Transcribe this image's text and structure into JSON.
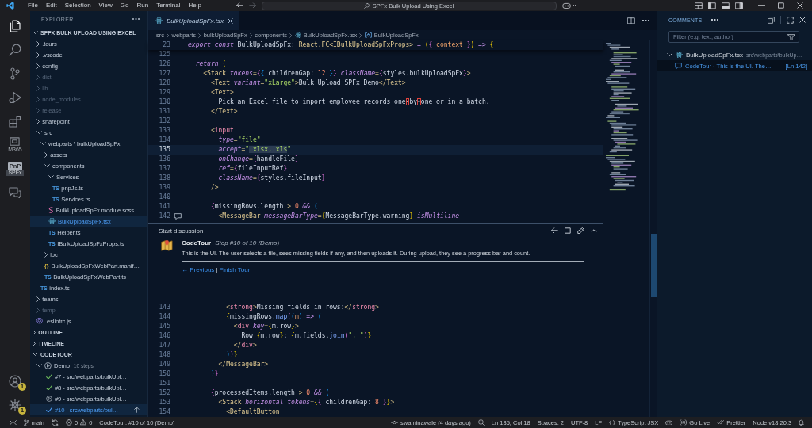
{
  "title_bar": {
    "menu": [
      "File",
      "Edit",
      "Selection",
      "View",
      "Go",
      "Run",
      "Terminal",
      "Help"
    ],
    "command_center": "SPFx Bulk Upload Using Excel"
  },
  "activity_bar": {
    "items": [
      {
        "kind": "explorer",
        "selected": true
      },
      {
        "kind": "search",
        "selected": false
      },
      {
        "kind": "scm",
        "selected": false
      },
      {
        "kind": "debug",
        "selected": false
      },
      {
        "kind": "extensions",
        "selected": false
      },
      {
        "kind": "toolkit",
        "selected": false,
        "caption": "M365"
      },
      {
        "kind": "pnp",
        "selected": false,
        "label": "PnP",
        "caption": "SPFx"
      },
      {
        "kind": "chat",
        "selected": false
      }
    ],
    "bottom": [
      {
        "kind": "account",
        "badge": "1"
      },
      {
        "kind": "settings",
        "badge": "1"
      }
    ]
  },
  "sidebar": {
    "title": "EXPLORER",
    "sections": [
      {
        "title": "SPFX BULK UPLOAD USING EXCEL",
        "kind": "files",
        "expanded": true,
        "tree": [
          {
            "name": ".tours",
            "kind": "folder",
            "expanded": false,
            "dimmed": false,
            "selected": false
          },
          {
            "name": ".vscode",
            "kind": "folder",
            "expanded": false,
            "dimmed": false,
            "selected": false
          },
          {
            "name": "config",
            "kind": "folder",
            "expanded": false,
            "dimmed": false,
            "selected": false
          },
          {
            "name": "dist",
            "kind": "folder",
            "expanded": false,
            "dimmed": true,
            "selected": false
          },
          {
            "name": "lib",
            "kind": "folder",
            "expanded": false,
            "dimmed": true,
            "selected": false
          },
          {
            "name": "node_modules",
            "kind": "folder",
            "expanded": false,
            "dimmed": true,
            "selected": false
          },
          {
            "name": "release",
            "kind": "folder",
            "expanded": false,
            "dimmed": true,
            "selected": false
          },
          {
            "name": "sharepoint",
            "kind": "folder",
            "expanded": false,
            "dimmed": false,
            "selected": false
          },
          {
            "name": "src",
            "kind": "folder",
            "expanded": true,
            "dimmed": false,
            "selected": false,
            "children": [
              {
                "name": "webparts \\ bulkUploadSpFx",
                "kind": "folder",
                "expanded": true,
                "dimmed": false,
                "selected": false,
                "children": [
                  {
                    "name": "assets",
                    "kind": "folder",
                    "expanded": false,
                    "dimmed": false,
                    "selected": false
                  },
                  {
                    "name": "components",
                    "kind": "folder",
                    "expanded": true,
                    "dimmed": false,
                    "selected": false,
                    "children": [
                      {
                        "name": "Services",
                        "kind": "folder",
                        "expanded": true,
                        "dimmed": false,
                        "selected": false,
                        "children": [
                          {
                            "name": "pnpJs.ts",
                            "kind": "ts",
                            "glyph": "TS",
                            "dimmed": false,
                            "selected": false
                          },
                          {
                            "name": "Services.ts",
                            "kind": "ts",
                            "glyph": "TS",
                            "dimmed": false,
                            "selected": false
                          }
                        ]
                      },
                      {
                        "name": "BulkUploadSpFx.module.scss",
                        "kind": "scss",
                        "dimmed": false,
                        "selected": false
                      },
                      {
                        "name": "BulkUploadSpFx.tsx",
                        "kind": "tsx",
                        "dimmed": false,
                        "selected": true
                      },
                      {
                        "name": "Helper.ts",
                        "kind": "ts",
                        "glyph": "TS",
                        "dimmed": false,
                        "selected": false
                      },
                      {
                        "name": "IBulkUploadSpFxProps.ts",
                        "kind": "ts",
                        "glyph": "TS",
                        "dimmed": false,
                        "selected": false
                      }
                    ]
                  },
                  {
                    "name": "loc",
                    "kind": "folder",
                    "expanded": false,
                    "dimmed": false,
                    "selected": false
                  },
                  {
                    "name": "BulkUploadSpFxWebPart.manif…",
                    "kind": "json",
                    "glyph": "{}",
                    "dimmed": false,
                    "selected": false
                  },
                  {
                    "name": "BulkUploadSpFxWebPart.ts",
                    "kind": "ts",
                    "glyph": "TS",
                    "dimmed": false,
                    "selected": false
                  }
                ]
              },
              {
                "name": "index.ts",
                "kind": "ts",
                "glyph": "TS",
                "dimmed": false,
                "selected": false
              }
            ]
          },
          {
            "name": "teams",
            "kind": "folder",
            "expanded": false,
            "dimmed": false,
            "selected": false
          },
          {
            "name": "temp",
            "kind": "folder",
            "expanded": false,
            "dimmed": true,
            "selected": false
          },
          {
            "name": ".eslintrc.js",
            "kind": "eslint",
            "dimmed": false,
            "selected": false
          }
        ]
      },
      {
        "title": "OUTLINE",
        "expanded": false
      },
      {
        "title": "TIMELINE",
        "expanded": false
      },
      {
        "title": "CODETOUR",
        "kind": "tours",
        "expanded": true,
        "tours": [
          {
            "name": "Demo",
            "description": "10 steps",
            "expanded": true,
            "steps": [
              {
                "label": "#7 - src/webparts/bulkUpl…",
                "kind": "visited",
                "selected": false
              },
              {
                "label": "#8 - src/webparts/bulkUpl…",
                "kind": "visited",
                "selected": false
              },
              {
                "label": "#9 - src/webparts/bulkUpl…",
                "kind": "unvisited",
                "selected": false
              },
              {
                "label": "#10 - src/webparts/bul…",
                "kind": "visited",
                "selected": true
              }
            ]
          }
        ]
      }
    ]
  },
  "editor": {
    "tabs": [
      {
        "label": "BulkUploadSpFx.tsx",
        "selected": true,
        "preview": true
      }
    ],
    "breadcrumbs": [
      {
        "label": "src",
        "kind": "folder"
      },
      {
        "label": "webparts",
        "kind": "folder"
      },
      {
        "label": "bulkUploadSpFx",
        "kind": "folder"
      },
      {
        "label": "components",
        "kind": "folder"
      },
      {
        "label": "BulkUploadSpFx.tsx",
        "kind": "file"
      },
      {
        "label": "BulkUploadSpFx",
        "kind": "symbol"
      }
    ],
    "sticky_line": {
      "number": "23",
      "tokens": [
        {
          "text": "export const",
          "kind": "keyword"
        },
        {
          "text": " BulkUploadSpFx: ",
          "kind": "text"
        },
        {
          "text": "React.FC<IBulkUploadSpFxProps>",
          "kind": "tag"
        },
        {
          "text": " =",
          "kind": "keyword"
        },
        {
          "text": " (",
          "kind": "bracket"
        },
        {
          "text": "{",
          "kind": "bracket2"
        },
        {
          "text": " context",
          "kind": "param"
        },
        {
          "text": " }",
          "kind": "bracket2"
        },
        {
          "text": ")",
          "kind": "bracket"
        },
        {
          "text": " =>",
          "kind": "keyword"
        },
        {
          "text": " {",
          "kind": "bracket"
        }
      ]
    },
    "lines": [
      {
        "number": "125",
        "current": false,
        "comment": false
      },
      {
        "number": "126",
        "current": false,
        "comment": false,
        "tokens": [
          {
            "text": "  return ",
            "kind": "keyword"
          },
          {
            "text": "(",
            "kind": "bracket"
          }
        ]
      },
      {
        "number": "127",
        "current": false,
        "comment": false,
        "tokens": [
          {
            "text": "    <",
            "kind": "punct"
          },
          {
            "text": "Stack",
            "kind": "tag"
          },
          {
            "text": " tokens",
            "kind": "attr"
          },
          {
            "text": "=",
            "kind": "punct"
          },
          {
            "text": "{",
            "kind": "bracket2"
          },
          {
            "text": "{",
            "kind": "bracket3"
          },
          {
            "text": " childrenGap: ",
            "kind": "text"
          },
          {
            "text": "12",
            "kind": "number"
          },
          {
            "text": " }",
            "kind": "bracket3"
          },
          {
            "text": "}",
            "kind": "bracket2"
          },
          {
            "text": " className",
            "kind": "attr"
          },
          {
            "text": "=",
            "kind": "punct"
          },
          {
            "text": "{",
            "kind": "bracket2"
          },
          {
            "text": "styles.bulkUploadSpFx",
            "kind": "text"
          },
          {
            "text": "}",
            "kind": "bracket2"
          },
          {
            "text": ">",
            "kind": "punct"
          }
        ]
      },
      {
        "number": "128",
        "current": false,
        "comment": false,
        "tokens": [
          {
            "text": "      <",
            "kind": "punct"
          },
          {
            "text": "Text",
            "kind": "tag"
          },
          {
            "text": " variant",
            "kind": "attr"
          },
          {
            "text": "=",
            "kind": "punct"
          },
          {
            "text": "\"xLarge\"",
            "kind": "string"
          },
          {
            "text": ">",
            "kind": "punct"
          },
          {
            "text": "Bulk Upload SPFx Demo",
            "kind": "text"
          },
          {
            "text": "</",
            "kind": "punct"
          },
          {
            "text": "Text",
            "kind": "tag"
          },
          {
            "text": ">",
            "kind": "punct"
          }
        ]
      },
      {
        "number": "129",
        "current": false,
        "comment": false,
        "tokens": [
          {
            "text": "      <",
            "kind": "punct"
          },
          {
            "text": "Text",
            "kind": "tag"
          },
          {
            "text": ">",
            "kind": "punct"
          }
        ]
      },
      {
        "number": "130",
        "current": false,
        "comment": false,
        "tokens": [
          {
            "text": "        Pick an Excel file to import employee records one",
            "kind": "text"
          },
          {
            "text": "‐",
            "kind": "flag"
          },
          {
            "text": "by",
            "kind": "text"
          },
          {
            "text": "‐",
            "kind": "flag"
          },
          {
            "text": "one or in a batch.",
            "kind": "text"
          }
        ]
      },
      {
        "number": "131",
        "current": false,
        "comment": false,
        "tokens": [
          {
            "text": "      </",
            "kind": "punct"
          },
          {
            "text": "Text",
            "kind": "tag"
          },
          {
            "text": ">",
            "kind": "punct"
          }
        ]
      },
      {
        "number": "132",
        "current": false,
        "comment": false
      },
      {
        "number": "133",
        "current": false,
        "comment": false,
        "tokens": [
          {
            "text": "      <",
            "kind": "punct"
          },
          {
            "text": "input",
            "kind": "element"
          }
        ]
      },
      {
        "number": "134",
        "current": false,
        "comment": false,
        "tokens": [
          {
            "text": "        type",
            "kind": "attr"
          },
          {
            "text": "=",
            "kind": "punct"
          },
          {
            "text": "\"file\"",
            "kind": "string"
          }
        ]
      },
      {
        "number": "135",
        "current": true,
        "comment": false,
        "tokens": [
          {
            "text": "        accept",
            "kind": "attr"
          },
          {
            "text": "=",
            "kind": "punct"
          },
          {
            "text": "\"",
            "kind": "string"
          },
          {
            "text": ".xlsx,.xls",
            "kind": "match"
          },
          {
            "text": "\"",
            "kind": "string"
          }
        ]
      },
      {
        "number": "136",
        "current": false,
        "comment": false,
        "tokens": [
          {
            "text": "        onChange",
            "kind": "attr"
          },
          {
            "text": "=",
            "kind": "punct"
          },
          {
            "text": "{",
            "kind": "bracket2"
          },
          {
            "text": "handleFile",
            "kind": "text"
          },
          {
            "text": "}",
            "kind": "bracket2"
          }
        ]
      },
      {
        "number": "137",
        "current": false,
        "comment": false,
        "tokens": [
          {
            "text": "        ref",
            "kind": "attr"
          },
          {
            "text": "=",
            "kind": "punct"
          },
          {
            "text": "{",
            "kind": "bracket2"
          },
          {
            "text": "fileInputRef",
            "kind": "text"
          },
          {
            "text": "}",
            "kind": "bracket2"
          }
        ]
      },
      {
        "number": "138",
        "current": false,
        "comment": false,
        "tokens": [
          {
            "text": "        className",
            "kind": "attr"
          },
          {
            "text": "=",
            "kind": "punct"
          },
          {
            "text": "{",
            "kind": "bracket2"
          },
          {
            "text": "styles.fileInput",
            "kind": "text"
          },
          {
            "text": "}",
            "kind": "bracket2"
          }
        ]
      },
      {
        "number": "139",
        "current": false,
        "comment": false,
        "tokens": [
          {
            "text": "      />",
            "kind": "punct"
          }
        ]
      },
      {
        "number": "140",
        "current": false,
        "comment": false
      },
      {
        "number": "141",
        "current": false,
        "comment": false,
        "tokens": [
          {
            "text": "      {",
            "kind": "bracket2"
          },
          {
            "text": "missingRows.length ",
            "kind": "text"
          },
          {
            "text": ">",
            "kind": "punct"
          },
          {
            "text": " 0",
            "kind": "number"
          },
          {
            "text": " &&",
            "kind": "keyword"
          },
          {
            "text": " (",
            "kind": "bracket3"
          }
        ]
      },
      {
        "number": "142",
        "current": false,
        "comment": true,
        "tokens": [
          {
            "text": "        <",
            "kind": "punct"
          },
          {
            "text": "MessageBar",
            "kind": "tag"
          },
          {
            "text": " messageBarType",
            "kind": "attr"
          },
          {
            "text": "=",
            "kind": "punct"
          },
          {
            "text": "{",
            "kind": "bracket"
          },
          {
            "text": "MessageBarType.warning",
            "kind": "text"
          },
          {
            "text": "}",
            "kind": "bracket"
          },
          {
            "text": " isMultiline",
            "kind": "attr"
          }
        ]
      }
    ],
    "comment_thread": {
      "header": "Start discussion",
      "author": "CodeTour",
      "subtitle": "Step #10 of 10 (Demo)",
      "body": "This is the UI. The user selects a file, sees missing fields if any, and then uploads it. During upload, they see a progress bar and count.",
      "links": [
        "← Previous",
        "Finish Tour"
      ],
      "separator": "|"
    },
    "more_lines": [
      {
        "number": "143",
        "current": false,
        "comment": false,
        "tokens": [
          {
            "text": "          <",
            "kind": "punct"
          },
          {
            "text": "strong",
            "kind": "element"
          },
          {
            "text": ">",
            "kind": "punct"
          },
          {
            "text": "Missing fields in rows:",
            "kind": "text"
          },
          {
            "text": "</",
            "kind": "punct"
          },
          {
            "text": "strong",
            "kind": "element"
          },
          {
            "text": ">",
            "kind": "punct"
          }
        ]
      },
      {
        "number": "144",
        "current": false,
        "comment": false,
        "tokens": [
          {
            "text": "          {",
            "kind": "bracket"
          },
          {
            "text": "missingRows.",
            "kind": "text"
          },
          {
            "text": "map",
            "kind": "func"
          },
          {
            "text": "(",
            "kind": "bracket2"
          },
          {
            "text": "(",
            "kind": "bracket3"
          },
          {
            "text": "m",
            "kind": "param"
          },
          {
            "text": ")",
            "kind": "bracket3"
          },
          {
            "text": " =>",
            "kind": "keyword"
          },
          {
            "text": " (",
            "kind": "bracket3"
          }
        ]
      },
      {
        "number": "145",
        "current": false,
        "comment": false,
        "tokens": [
          {
            "text": "            <",
            "kind": "punct"
          },
          {
            "text": "div",
            "kind": "element"
          },
          {
            "text": " key",
            "kind": "attr"
          },
          {
            "text": "=",
            "kind": "punct"
          },
          {
            "text": "{",
            "kind": "bracket"
          },
          {
            "text": "m.row",
            "kind": "text"
          },
          {
            "text": "}",
            "kind": "bracket"
          },
          {
            "text": ">",
            "kind": "punct"
          }
        ]
      },
      {
        "number": "146",
        "current": false,
        "comment": false,
        "tokens": [
          {
            "text": "              Row ",
            "kind": "text"
          },
          {
            "text": "{",
            "kind": "bracket"
          },
          {
            "text": "m.row",
            "kind": "text"
          },
          {
            "text": "}",
            "kind": "bracket"
          },
          {
            "text": ": ",
            "kind": "text"
          },
          {
            "text": "{",
            "kind": "bracket"
          },
          {
            "text": "m.fields.",
            "kind": "text"
          },
          {
            "text": "join",
            "kind": "func"
          },
          {
            "text": "(",
            "kind": "bracket2"
          },
          {
            "text": "\", \"",
            "kind": "string"
          },
          {
            "text": ")",
            "kind": "bracket2"
          },
          {
            "text": "}",
            "kind": "bracket"
          }
        ]
      },
      {
        "number": "147",
        "current": false,
        "comment": false,
        "tokens": [
          {
            "text": "            </",
            "kind": "punct"
          },
          {
            "text": "div",
            "kind": "element"
          },
          {
            "text": ">",
            "kind": "punct"
          }
        ]
      },
      {
        "number": "148",
        "current": false,
        "comment": false,
        "tokens": [
          {
            "text": "          )",
            "kind": "bracket3"
          },
          {
            "text": ")",
            "kind": "bracket2"
          },
          {
            "text": "}",
            "kind": "bracket"
          }
        ]
      },
      {
        "number": "149",
        "current": false,
        "comment": false,
        "tokens": [
          {
            "text": "        </",
            "kind": "punct"
          },
          {
            "text": "MessageBar",
            "kind": "tag"
          },
          {
            "text": ">",
            "kind": "punct"
          }
        ]
      },
      {
        "number": "150",
        "current": false,
        "comment": false,
        "tokens": [
          {
            "text": "      )",
            "kind": "bracket3"
          },
          {
            "text": "}",
            "kind": "bracket2"
          }
        ]
      },
      {
        "number": "151",
        "current": false,
        "comment": false
      },
      {
        "number": "152",
        "current": false,
        "comment": false,
        "tokens": [
          {
            "text": "      {",
            "kind": "bracket2"
          },
          {
            "text": "processedItems.length ",
            "kind": "text"
          },
          {
            "text": ">",
            "kind": "punct"
          },
          {
            "text": " 0",
            "kind": "number"
          },
          {
            "text": " &&",
            "kind": "keyword"
          },
          {
            "text": " (",
            "kind": "bracket3"
          }
        ]
      },
      {
        "number": "153",
        "current": false,
        "comment": false,
        "tokens": [
          {
            "text": "        <",
            "kind": "punct"
          },
          {
            "text": "Stack",
            "kind": "tag"
          },
          {
            "text": " horizontal",
            "kind": "attr"
          },
          {
            "text": " tokens",
            "kind": "attr"
          },
          {
            "text": "=",
            "kind": "punct"
          },
          {
            "text": "{",
            "kind": "bracket"
          },
          {
            "text": "{",
            "kind": "bracket2"
          },
          {
            "text": " childrenGap: ",
            "kind": "text"
          },
          {
            "text": "8",
            "kind": "number"
          },
          {
            "text": " }",
            "kind": "bracket2"
          },
          {
            "text": "}",
            "kind": "bracket"
          },
          {
            "text": ">",
            "kind": "punct"
          }
        ]
      },
      {
        "number": "154",
        "current": false,
        "comment": false,
        "tokens": [
          {
            "text": "          <",
            "kind": "punct"
          },
          {
            "text": "DefaultButton",
            "kind": "tag"
          }
        ]
      }
    ]
  },
  "comments_panel": {
    "title": "COMMENTS",
    "filter": {
      "placeholder": "Filter (e.g. text, author)"
    },
    "files": [
      {
        "name": "BulkUploadSpFx.tsx",
        "path": "src\\webparts\\bulkUp…",
        "expanded": true,
        "comments": [
          {
            "label": "CodeTour · This is the UI. The…",
            "line": "[Ln 142]",
            "selected": true
          }
        ]
      }
    ]
  },
  "status_bar": {
    "left": [
      {
        "kind": "remote"
      },
      {
        "kind": "branch",
        "text": "main"
      },
      {
        "kind": "sync"
      },
      {
        "kind": "problems",
        "errors": "0",
        "warnings": "0"
      },
      {
        "kind": "text",
        "text": "CodeTour: #10 of 10 (Demo)"
      }
    ],
    "right": [
      {
        "kind": "blame",
        "text": "swaminawale (4 days ago)"
      },
      {
        "kind": "zoom"
      },
      {
        "kind": "text",
        "text": "Ln 135, Col 18"
      },
      {
        "kind": "text",
        "text": "Spaces: 2"
      },
      {
        "kind": "text",
        "text": "UTF-8"
      },
      {
        "kind": "text",
        "text": "LF"
      },
      {
        "kind": "language",
        "text": "TypeScript JSX"
      },
      {
        "kind": "copilot"
      },
      {
        "kind": "live",
        "text": "Go Live"
      },
      {
        "kind": "prettier",
        "text": "Prettier"
      },
      {
        "kind": "text",
        "text": "Node v18.20.3"
      },
      {
        "kind": "bell"
      }
    ]
  }
}
